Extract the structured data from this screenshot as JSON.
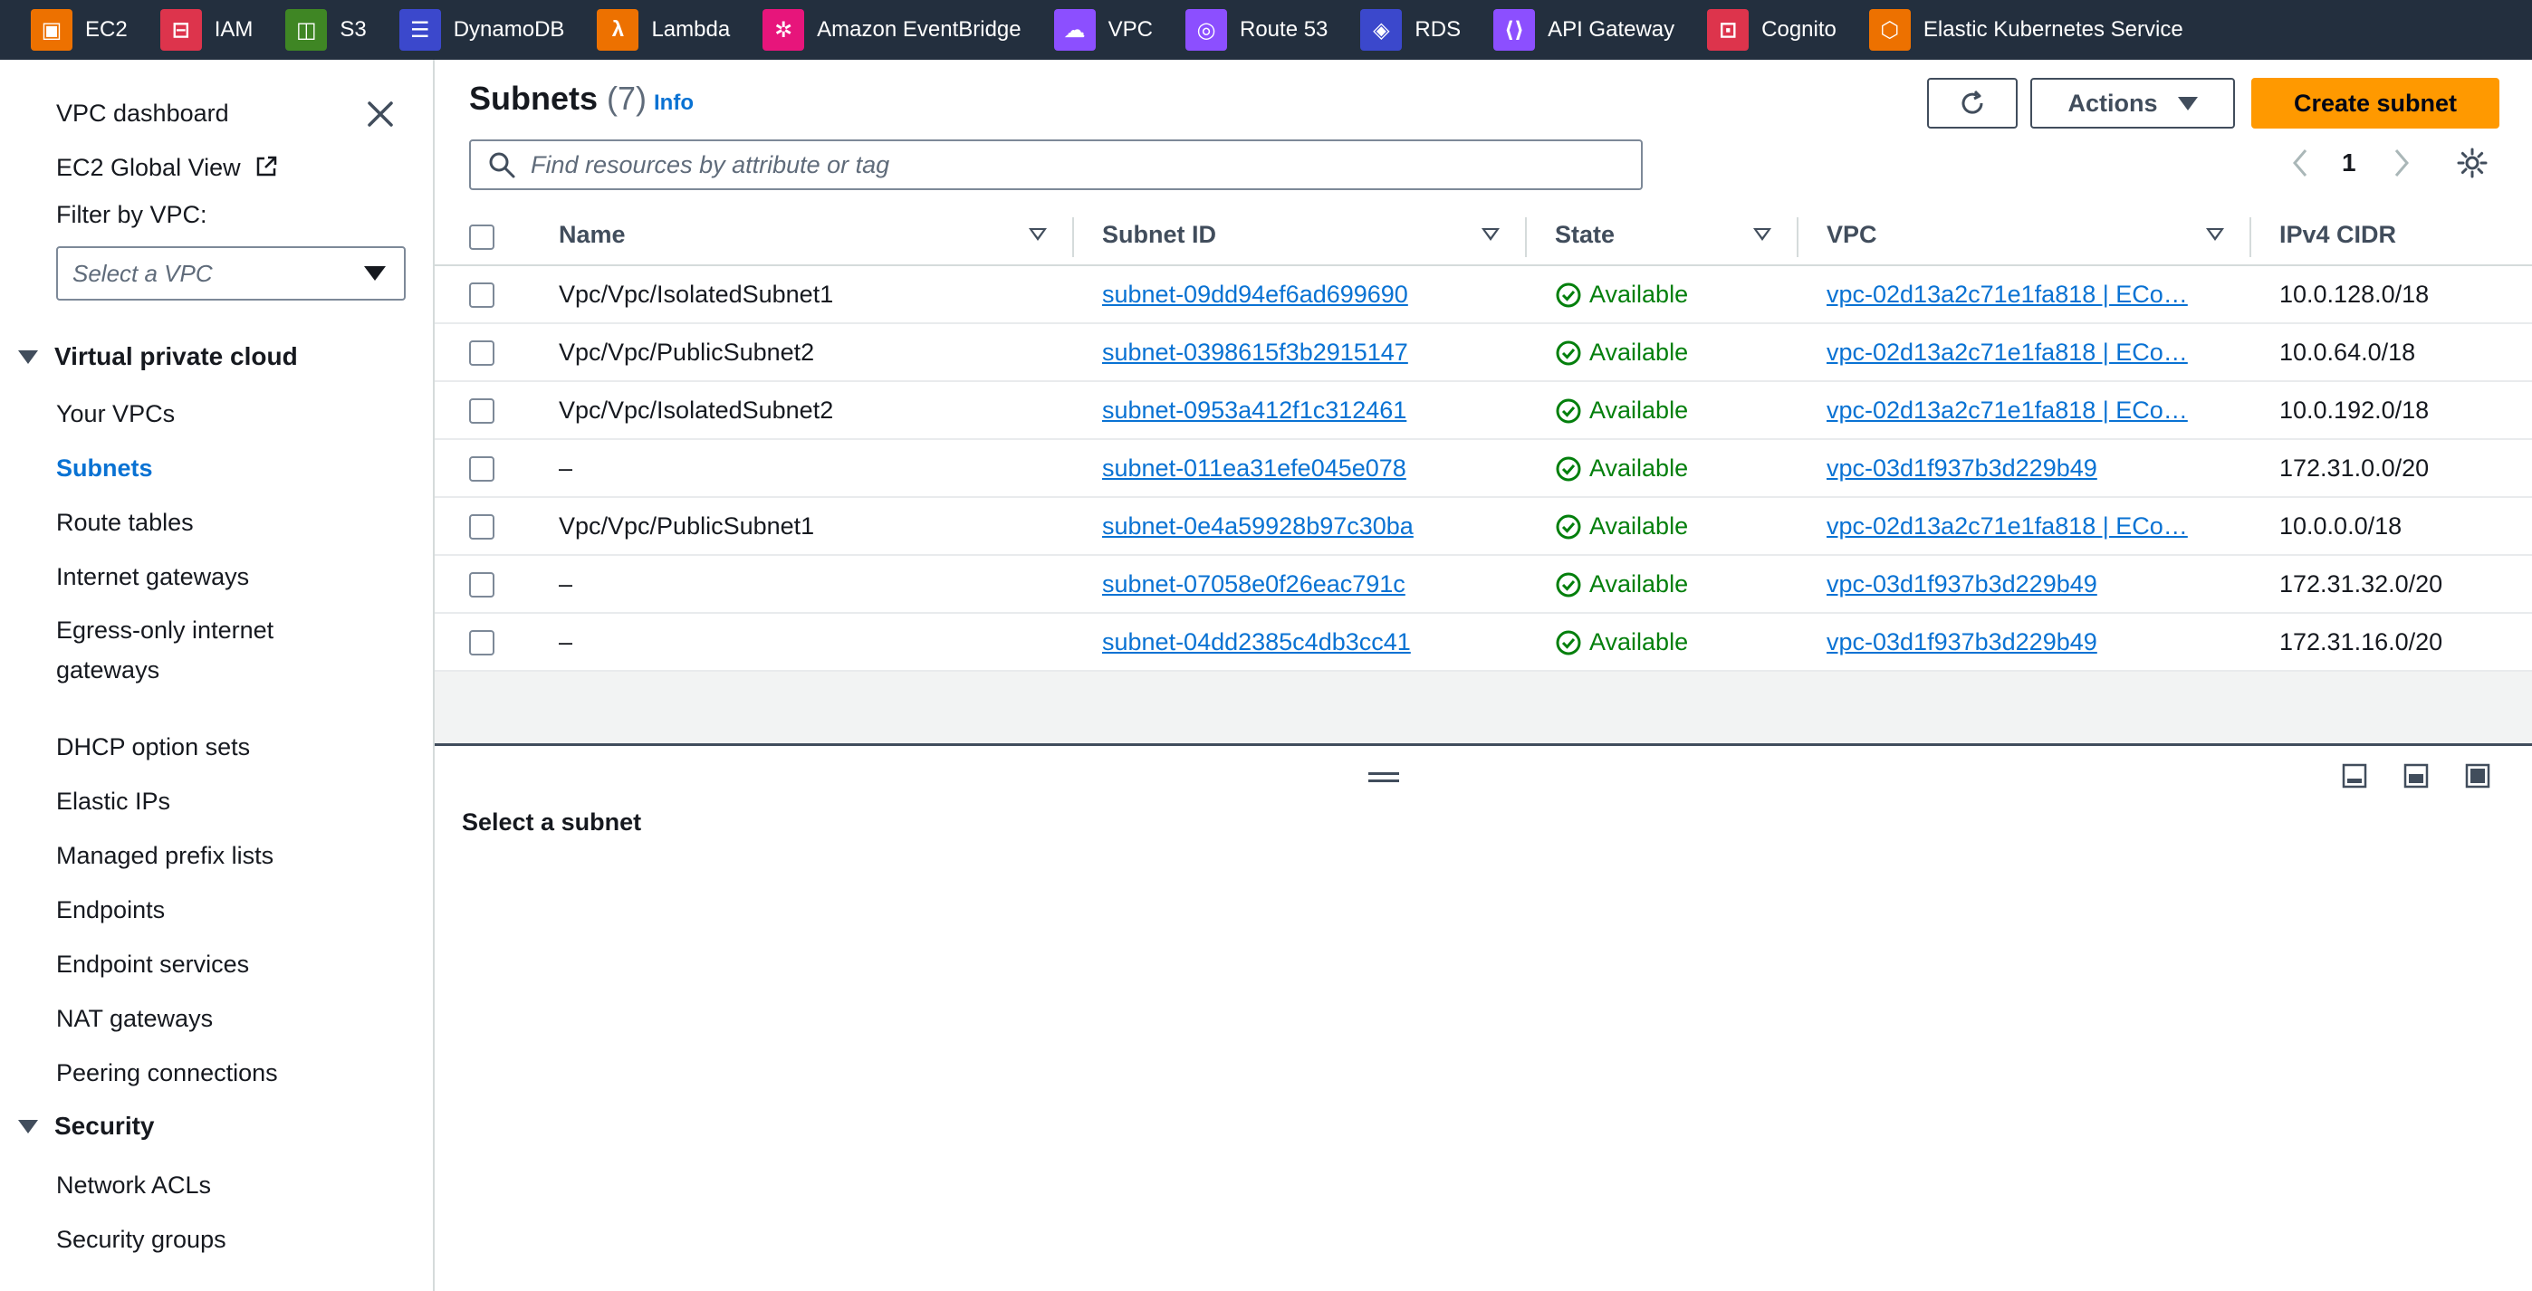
{
  "colors": {
    "topbar": "#232f3e",
    "accent": "#0972d3",
    "primary_button": "#ff9900",
    "success": "#037f0c"
  },
  "topbar": {
    "services": [
      {
        "label": "EC2",
        "icon": "ec2-icon",
        "color": "#ed7100"
      },
      {
        "label": "IAM",
        "icon": "iam-icon",
        "color": "#dd344c"
      },
      {
        "label": "S3",
        "icon": "s3-icon",
        "color": "#3f8624"
      },
      {
        "label": "DynamoDB",
        "icon": "dynamodb-icon",
        "color": "#3b48cc"
      },
      {
        "label": "Lambda",
        "icon": "lambda-icon",
        "color": "#ed7100"
      },
      {
        "label": "Amazon EventBridge",
        "icon": "eventbridge-icon",
        "color": "#e7157b"
      },
      {
        "label": "VPC",
        "icon": "vpc-icon",
        "color": "#8c4fff"
      },
      {
        "label": "Route 53",
        "icon": "route53-icon",
        "color": "#8c4fff"
      },
      {
        "label": "RDS",
        "icon": "rds-icon",
        "color": "#3b48cc"
      },
      {
        "label": "API Gateway",
        "icon": "api-gateway-icon",
        "color": "#8c4fff"
      },
      {
        "label": "Cognito",
        "icon": "cognito-icon",
        "color": "#dd344c"
      },
      {
        "label": "Elastic Kubernetes Service",
        "icon": "eks-icon",
        "color": "#ed7100"
      }
    ]
  },
  "sidebar": {
    "dashboard": "VPC dashboard",
    "global_view": "EC2 Global View",
    "filter_label": "Filter by VPC:",
    "filter_placeholder": "Select a VPC",
    "section_vpc": "Virtual private cloud",
    "vpc_items": [
      "Your VPCs",
      "Subnets",
      "Route tables",
      "Internet gateways",
      "Egress-only internet gateways",
      "DHCP option sets",
      "Elastic IPs",
      "Managed prefix lists",
      "Endpoints",
      "Endpoint services",
      "NAT gateways",
      "Peering connections"
    ],
    "active_item": "Subnets",
    "section_security": "Security",
    "security_items": [
      "Network ACLs",
      "Security groups"
    ]
  },
  "main": {
    "title": "Subnets",
    "count": "(7)",
    "info": "Info",
    "actions_label": "Actions",
    "create_label": "Create subnet",
    "search_placeholder": "Find resources by attribute or tag",
    "page": "1"
  },
  "table": {
    "columns": [
      "Name",
      "Subnet ID",
      "State",
      "VPC",
      "IPv4 CIDR"
    ],
    "rows": [
      {
        "name": "Vpc/Vpc/IsolatedSubnet1",
        "subnet_id": "subnet-09dd94ef6ad699690",
        "state": "Available",
        "vpc": "vpc-02d13a2c71e1fa818 | ECo…",
        "cidr": "10.0.128.0/18"
      },
      {
        "name": "Vpc/Vpc/PublicSubnet2",
        "subnet_id": "subnet-0398615f3b2915147",
        "state": "Available",
        "vpc": "vpc-02d13a2c71e1fa818 | ECo…",
        "cidr": "10.0.64.0/18"
      },
      {
        "name": "Vpc/Vpc/IsolatedSubnet2",
        "subnet_id": "subnet-0953a412f1c312461",
        "state": "Available",
        "vpc": "vpc-02d13a2c71e1fa818 | ECo…",
        "cidr": "10.0.192.0/18"
      },
      {
        "name": "–",
        "subnet_id": "subnet-011ea31efe045e078",
        "state": "Available",
        "vpc": "vpc-03d1f937b3d229b49",
        "cidr": "172.31.0.0/20"
      },
      {
        "name": "Vpc/Vpc/PublicSubnet1",
        "subnet_id": "subnet-0e4a59928b97c30ba",
        "state": "Available",
        "vpc": "vpc-02d13a2c71e1fa818 | ECo…",
        "cidr": "10.0.0.0/18"
      },
      {
        "name": "–",
        "subnet_id": "subnet-07058e0f26eac791c",
        "state": "Available",
        "vpc": "vpc-03d1f937b3d229b49",
        "cidr": "172.31.32.0/20"
      },
      {
        "name": "–",
        "subnet_id": "subnet-04dd2385c4db3cc41",
        "state": "Available",
        "vpc": "vpc-03d1f937b3d229b49",
        "cidr": "172.31.16.0/20"
      }
    ]
  },
  "split_panel": {
    "title": "Select a subnet"
  }
}
